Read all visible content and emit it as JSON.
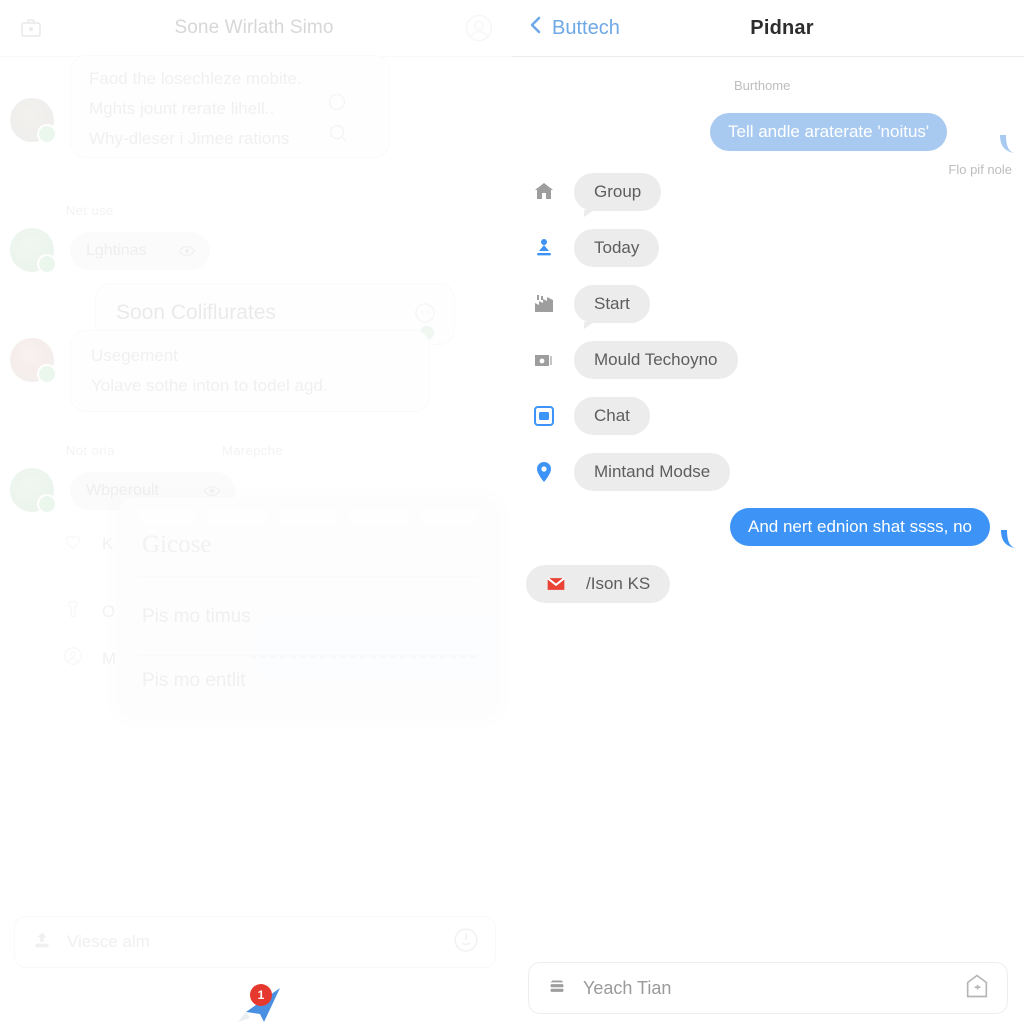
{
  "left": {
    "topbar": {
      "title": "Sone Wirlath Simo",
      "briefcase_icon": "briefcase-icon",
      "avatar_icon": "profile-avatar-icon"
    },
    "top_card": {
      "lines": [
        "Faod the losechleze mobite.",
        "Mghts jount rerate lihell..",
        "Why-dleser i Jimee rations"
      ],
      "circle_icon": "circle-icon",
      "search_icon": "search-icon"
    },
    "sections": [
      {
        "label": "Net  use"
      },
      {
        "label": "Not  oria"
      },
      {
        "label": "Marepche"
      }
    ],
    "pill_1": {
      "text": "Lghtinas",
      "icon": "eye-icon"
    },
    "pill_2": {
      "text": "Wbperoult",
      "icon": "eye-icon"
    },
    "mid_card": {
      "title": "Soon Coliflurates",
      "badge_icon": "quote-icon"
    },
    "sub_card": {
      "line1": "Usegement",
      "line2": "Yolave sothe inton to todel agd."
    },
    "list_rows": [
      {
        "label": "K",
        "icon": "heart-icon"
      },
      {
        "label": "O",
        "icon": "shirt-icon"
      },
      {
        "label": "M",
        "icon": "user-circle-icon"
      }
    ],
    "overlay": {
      "serif_title": "Gicose",
      "item_1": "Pis mo timus",
      "item_2": "Pis mo entlit"
    },
    "input": {
      "placeholder": "Viesce alm",
      "left_icon": "upload-icon",
      "right_icon": "power-smiley-icon"
    },
    "cursor": {
      "badge_count": "1",
      "icon": "pointer-arrow-icon"
    }
  },
  "right": {
    "topbar": {
      "back_label": "Buttech",
      "back_icon": "chevron-left-icon",
      "title": "Pidnar"
    },
    "messages": [
      {
        "type": "timestamp",
        "text": "Burthome"
      },
      {
        "type": "bubble_light",
        "text": "Tell andle araterate 'noitus'"
      },
      {
        "type": "timestamp_right",
        "text": "Flo pif nole"
      }
    ],
    "chips": [
      {
        "label": "Group",
        "icon": "home-icon",
        "icon_color": "#9e9e9e",
        "tail": true
      },
      {
        "label": "Today",
        "icon": "download-icon",
        "icon_color": "#3d94f6",
        "tail": false
      },
      {
        "label": "Start",
        "icon": "factory-icon",
        "icon_color": "#9e9e9e",
        "tail": true
      },
      {
        "label": "Mould Techoyno",
        "icon": "camera-icon",
        "icon_color": "#9e9e9e",
        "tail": false
      },
      {
        "label": "Chat",
        "icon": "chat-square-icon",
        "icon_color": "#3d94f6",
        "tail": false
      },
      {
        "label": "Mintand Modse",
        "icon": "map-pin-icon",
        "icon_color": "#3d94f6",
        "tail": false
      }
    ],
    "bubble_bottom": {
      "text": "And nert ednion shat ssss, no"
    },
    "mail_chip": {
      "label": "/Ison KS",
      "icon": "mail-icon",
      "icon_color": "#ea4335"
    },
    "input": {
      "placeholder": "Yeach Tian",
      "left_icon": "briefcase-icon",
      "right_icon": "house-plus-icon"
    }
  },
  "colors": {
    "accent_blue": "#3d94f6",
    "light_blue": "#a8caf0",
    "link_blue": "#6ea8e6",
    "chip_bg": "#ececec",
    "mail_red": "#ea4335",
    "badge_red": "#e5392f"
  }
}
